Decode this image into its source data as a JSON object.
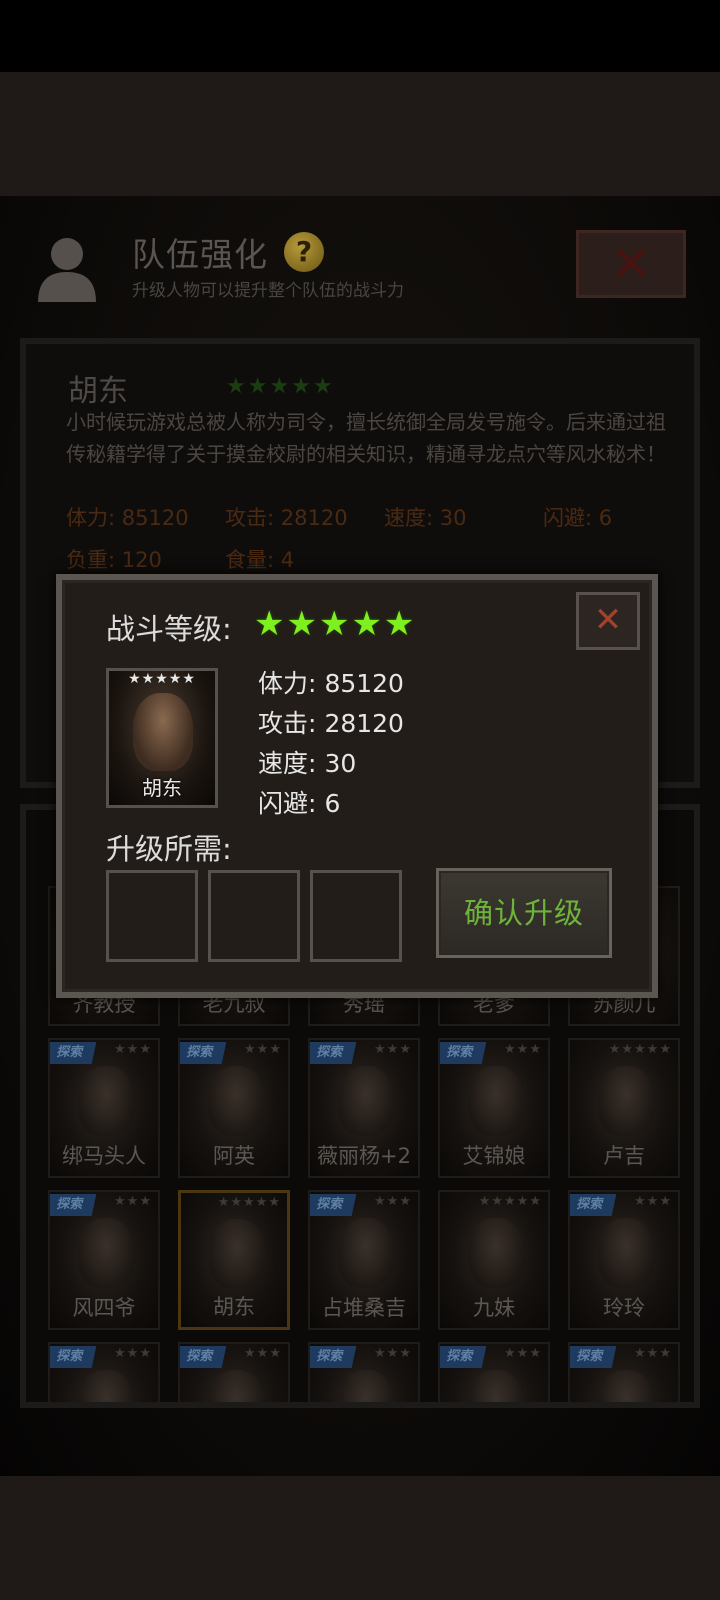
{
  "header": {
    "title": "队伍强化",
    "help_glyph": "?",
    "subtitle": "升级人物可以提升整个队伍的战斗力",
    "close_glyph": "✕"
  },
  "card": {
    "name": "胡东",
    "stars": "★★★★★",
    "description": "小时候玩游戏总被人称为司令，擅长统御全局发号施令。后来通过祖传秘籍学得了关于摸金校尉的相关知识，精通寻龙点穴等风水秘术！",
    "stats_row1": [
      "体力: 85120",
      "攻击: 28120",
      "速度: 30",
      "闪避: 6"
    ],
    "stats_row2": [
      "负重: 120",
      "食量: 4"
    ]
  },
  "roster": [
    {
      "name": "齐教授",
      "stars": "",
      "tag": ""
    },
    {
      "name": "老九叔",
      "stars": "",
      "tag": ""
    },
    {
      "name": "秀瑶",
      "stars": "",
      "tag": ""
    },
    {
      "name": "老爹",
      "stars": "",
      "tag": ""
    },
    {
      "name": "苏颜儿",
      "stars": "",
      "tag": ""
    },
    {
      "name": "绑马头人",
      "stars": "★★★",
      "tag": "探索"
    },
    {
      "name": "阿英",
      "stars": "★★★",
      "tag": "探索"
    },
    {
      "name": "薇丽杨+2",
      "stars": "★★★",
      "tag": "探索"
    },
    {
      "name": "艾锦娘",
      "stars": "★★★",
      "tag": "探索"
    },
    {
      "name": "卢吉",
      "stars": "★★★★★",
      "tag": ""
    },
    {
      "name": "风四爷",
      "stars": "★★★",
      "tag": "探索"
    },
    {
      "name": "胡东",
      "stars": "★★★★★",
      "tag": ""
    },
    {
      "name": "占堆桑吉",
      "stars": "★★★",
      "tag": "探索"
    },
    {
      "name": "九妹",
      "stars": "★★★★★",
      "tag": ""
    },
    {
      "name": "玲玲",
      "stars": "★★★",
      "tag": "探索"
    },
    {
      "name": "",
      "stars": "★★★",
      "tag": "探索"
    },
    {
      "name": "",
      "stars": "★★★",
      "tag": "探索"
    },
    {
      "name": "",
      "stars": "★★★",
      "tag": "探索"
    },
    {
      "name": "",
      "stars": "★★★",
      "tag": "探索"
    },
    {
      "name": "",
      "stars": "★★★",
      "tag": "探索"
    }
  ],
  "modal": {
    "close_glyph": "✕",
    "level_label": "战斗等级:",
    "level_stars": "★★★★★",
    "hero": {
      "name": "胡东",
      "stars": "★★★★★"
    },
    "stats": [
      {
        "label": "体力:",
        "value": "85120"
      },
      {
        "label": "攻击:",
        "value": "28120"
      },
      {
        "label": "速度:",
        "value": "30"
      },
      {
        "label": "闪避:",
        "value": "6"
      }
    ],
    "requirements_label": "升级所需:",
    "confirm_label": "确认升级"
  }
}
